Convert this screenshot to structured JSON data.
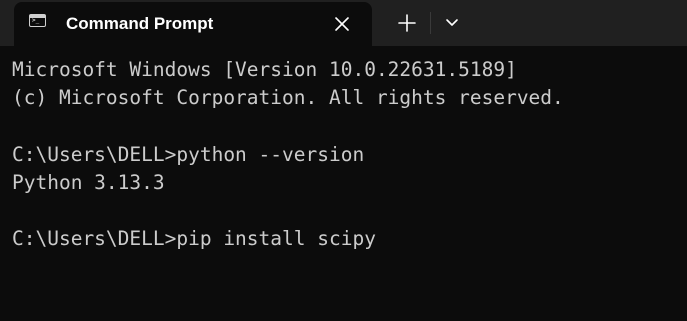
{
  "window": {
    "tab_title": "Command Prompt",
    "tab_icon": "cmd-icon",
    "tab_icon_text": ">_"
  },
  "titlebar": {
    "close_icon": "close-icon",
    "new_tab_icon": "plus-icon",
    "dropdown_icon": "chevron-down-icon"
  },
  "terminal": {
    "lines": [
      "Microsoft Windows [Version 10.0.22631.5189]",
      "(c) Microsoft Corporation. All rights reserved.",
      "",
      "C:\\Users\\DELL>python --version",
      "Python 3.13.3",
      "",
      "C:\\Users\\DELL>pip install scipy"
    ]
  },
  "colors": {
    "background": "#0c0c0c",
    "titlebar": "#202020",
    "text": "#cccccc"
  }
}
